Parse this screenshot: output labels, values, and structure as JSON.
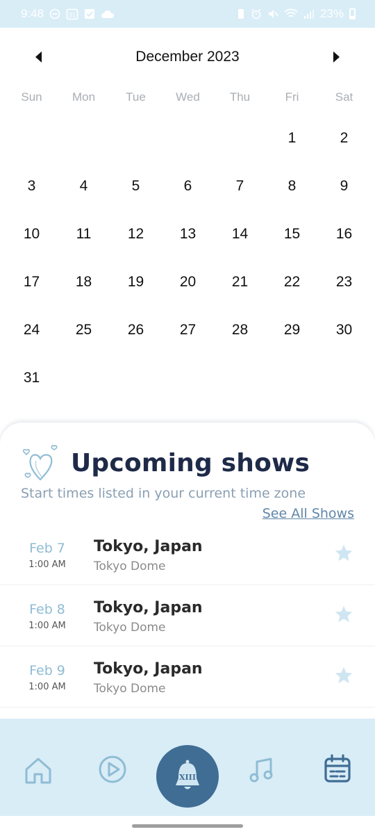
{
  "status_bar": {
    "time": "9:48",
    "battery": "23%",
    "left_icons": [
      "minus-circle-icon",
      "calendar-31-icon",
      "checkbox-icon",
      "cloud-icon"
    ],
    "right_icons": [
      "vibrate-icon",
      "alarm-icon",
      "mute-icon",
      "wifi-icon",
      "signal-icon",
      "battery-icon"
    ],
    "calendar_badge": "31"
  },
  "calendar": {
    "month_title": "December 2023",
    "weekdays": [
      "Sun",
      "Mon",
      "Tue",
      "Wed",
      "Thu",
      "Fri",
      "Sat"
    ],
    "days": [
      "",
      "",
      "",
      "",
      "",
      "1",
      "2",
      "3",
      "4",
      "5",
      "6",
      "7",
      "8",
      "9",
      "10",
      "11",
      "12",
      "13",
      "14",
      "15",
      "16",
      "17",
      "18",
      "19",
      "20",
      "21",
      "22",
      "23",
      "24",
      "25",
      "26",
      "27",
      "28",
      "29",
      "30",
      "31",
      "",
      "",
      "",
      "",
      "",
      ""
    ]
  },
  "upcoming": {
    "title": "Upcoming shows",
    "subtitle": "Start times listed in your current time zone",
    "see_all_label": "See All Shows",
    "shows": [
      {
        "date": "Feb 7",
        "time": "1:00 AM",
        "city": "Tokyo, Japan",
        "venue": "Tokyo Dome"
      },
      {
        "date": "Feb 8",
        "time": "1:00 AM",
        "city": "Tokyo, Japan",
        "venue": "Tokyo Dome"
      },
      {
        "date": "Feb 9",
        "time": "1:00 AM",
        "city": "Tokyo, Japan",
        "venue": "Tokyo Dome"
      }
    ]
  },
  "bottom_nav": {
    "items": [
      "home-icon",
      "play-icon",
      "bell-icon",
      "music-note-icon",
      "calendar-icon"
    ],
    "center_badge": "XIII",
    "active": "calendar-icon"
  },
  "colors": {
    "accent": "#406d94",
    "nav_background": "#d9edf7",
    "title": "#1e2a48",
    "date_blue": "#8fbcd4",
    "star": "#cfe6f2"
  }
}
